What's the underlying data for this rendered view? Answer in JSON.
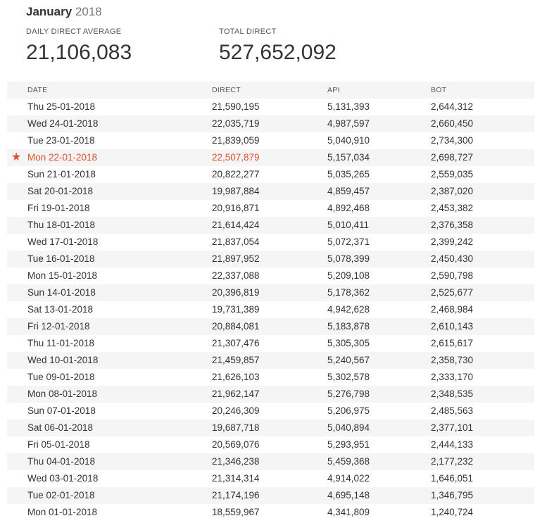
{
  "header": {
    "month": "January",
    "year": "2018"
  },
  "stats": {
    "avg_label": "DAILY DIRECT AVERAGE",
    "avg_value": "21,106,083",
    "total_label": "TOTAL DIRECT",
    "total_value": "527,652,092"
  },
  "table": {
    "columns": [
      "DATE",
      "DIRECT",
      "API",
      "BOT"
    ],
    "highlight_color": "#e04e2e",
    "star_icon": "★",
    "rows": [
      {
        "date": "Thu 25-01-2018",
        "direct": "21,590,195",
        "api": "5,131,393",
        "bot": "2,644,312"
      },
      {
        "date": "Wed 24-01-2018",
        "direct": "22,035,719",
        "api": "4,987,597",
        "bot": "2,660,450"
      },
      {
        "date": "Tue 23-01-2018",
        "direct": "21,839,059",
        "api": "5,040,910",
        "bot": "2,734,300"
      },
      {
        "date": "Mon 22-01-2018",
        "direct": "22,507,879",
        "api": "5,157,034",
        "bot": "2,698,727",
        "highlight": true
      },
      {
        "date": "Sun 21-01-2018",
        "direct": "20,822,277",
        "api": "5,035,265",
        "bot": "2,559,035"
      },
      {
        "date": "Sat 20-01-2018",
        "direct": "19,987,884",
        "api": "4,859,457",
        "bot": "2,387,020"
      },
      {
        "date": "Fri 19-01-2018",
        "direct": "20,916,871",
        "api": "4,892,468",
        "bot": "2,453,382"
      },
      {
        "date": "Thu 18-01-2018",
        "direct": "21,614,424",
        "api": "5,010,411",
        "bot": "2,376,358"
      },
      {
        "date": "Wed 17-01-2018",
        "direct": "21,837,054",
        "api": "5,072,371",
        "bot": "2,399,242"
      },
      {
        "date": "Tue 16-01-2018",
        "direct": "21,897,952",
        "api": "5,078,399",
        "bot": "2,450,430"
      },
      {
        "date": "Mon 15-01-2018",
        "direct": "22,337,088",
        "api": "5,209,108",
        "bot": "2,590,798"
      },
      {
        "date": "Sun 14-01-2018",
        "direct": "20,396,819",
        "api": "5,178,362",
        "bot": "2,525,677"
      },
      {
        "date": "Sat 13-01-2018",
        "direct": "19,731,389",
        "api": "4,942,628",
        "bot": "2,468,984"
      },
      {
        "date": "Fri 12-01-2018",
        "direct": "20,884,081",
        "api": "5,183,878",
        "bot": "2,610,143"
      },
      {
        "date": "Thu 11-01-2018",
        "direct": "21,307,476",
        "api": "5,305,305",
        "bot": "2,615,617"
      },
      {
        "date": "Wed 10-01-2018",
        "direct": "21,459,857",
        "api": "5,240,567",
        "bot": "2,358,730"
      },
      {
        "date": "Tue 09-01-2018",
        "direct": "21,626,103",
        "api": "5,302,578",
        "bot": "2,333,170"
      },
      {
        "date": "Mon 08-01-2018",
        "direct": "21,962,147",
        "api": "5,276,798",
        "bot": "2,348,535"
      },
      {
        "date": "Sun 07-01-2018",
        "direct": "20,246,309",
        "api": "5,206,975",
        "bot": "2,485,563"
      },
      {
        "date": "Sat 06-01-2018",
        "direct": "19,687,718",
        "api": "5,040,894",
        "bot": "2,377,101"
      },
      {
        "date": "Fri 05-01-2018",
        "direct": "20,569,076",
        "api": "5,293,951",
        "bot": "2,444,133"
      },
      {
        "date": "Thu 04-01-2018",
        "direct": "21,346,238",
        "api": "5,459,368",
        "bot": "2,177,232"
      },
      {
        "date": "Wed 03-01-2018",
        "direct": "21,314,314",
        "api": "4,914,022",
        "bot": "1,646,051"
      },
      {
        "date": "Tue 02-01-2018",
        "direct": "21,174,196",
        "api": "4,695,148",
        "bot": "1,346,795"
      },
      {
        "date": "Mon 01-01-2018",
        "direct": "18,559,967",
        "api": "4,341,809",
        "bot": "1,240,724"
      }
    ]
  }
}
